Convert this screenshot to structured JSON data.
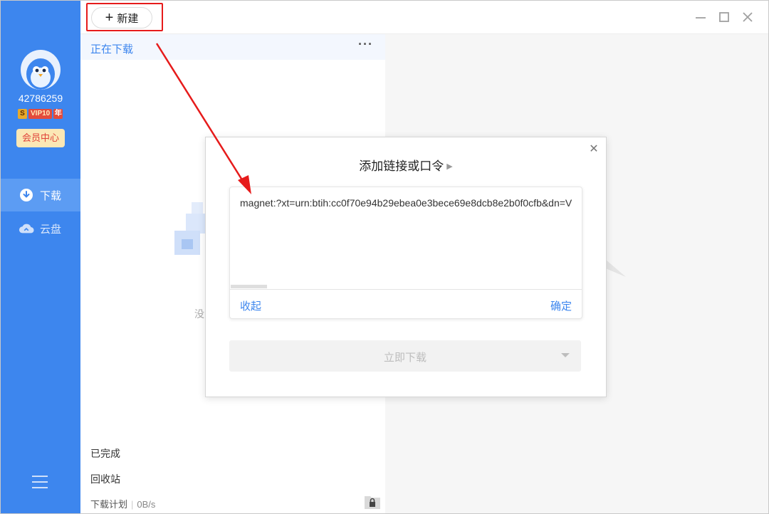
{
  "sidebar": {
    "user_id": "42786259",
    "vip_badge": {
      "s": "S",
      "tag": "VIP10",
      "year": "年"
    },
    "vip_center": "会员中心",
    "items": [
      {
        "label": "下载",
        "icon": "download-icon",
        "active": true
      },
      {
        "label": "云盘",
        "icon": "cloud-icon",
        "active": false
      }
    ],
    "menu_icon": "hamburger-menu-icon"
  },
  "topbar": {
    "new_button": "新建",
    "window_controls": [
      "minimize-icon",
      "maximize-icon",
      "close-icon"
    ]
  },
  "list": {
    "tab": "正在下载",
    "more_icon": "more-dots-icon",
    "empty_text": "没",
    "completed": "已完成",
    "recycle": "回收站",
    "plan": {
      "label": "下载计划",
      "speed": "0B/s"
    }
  },
  "dialog": {
    "title": "添加链接或口令",
    "link_text": "magnet:?xt=urn:btih:cc0f70e94b29ebea0e3bece69e8dcb8e2b0f0cfb&dn=V",
    "collapse": "收起",
    "confirm": "确定",
    "download_now": "立即下载"
  },
  "colors": {
    "accent": "#3d86ee",
    "annotation": "#e61b1b"
  }
}
